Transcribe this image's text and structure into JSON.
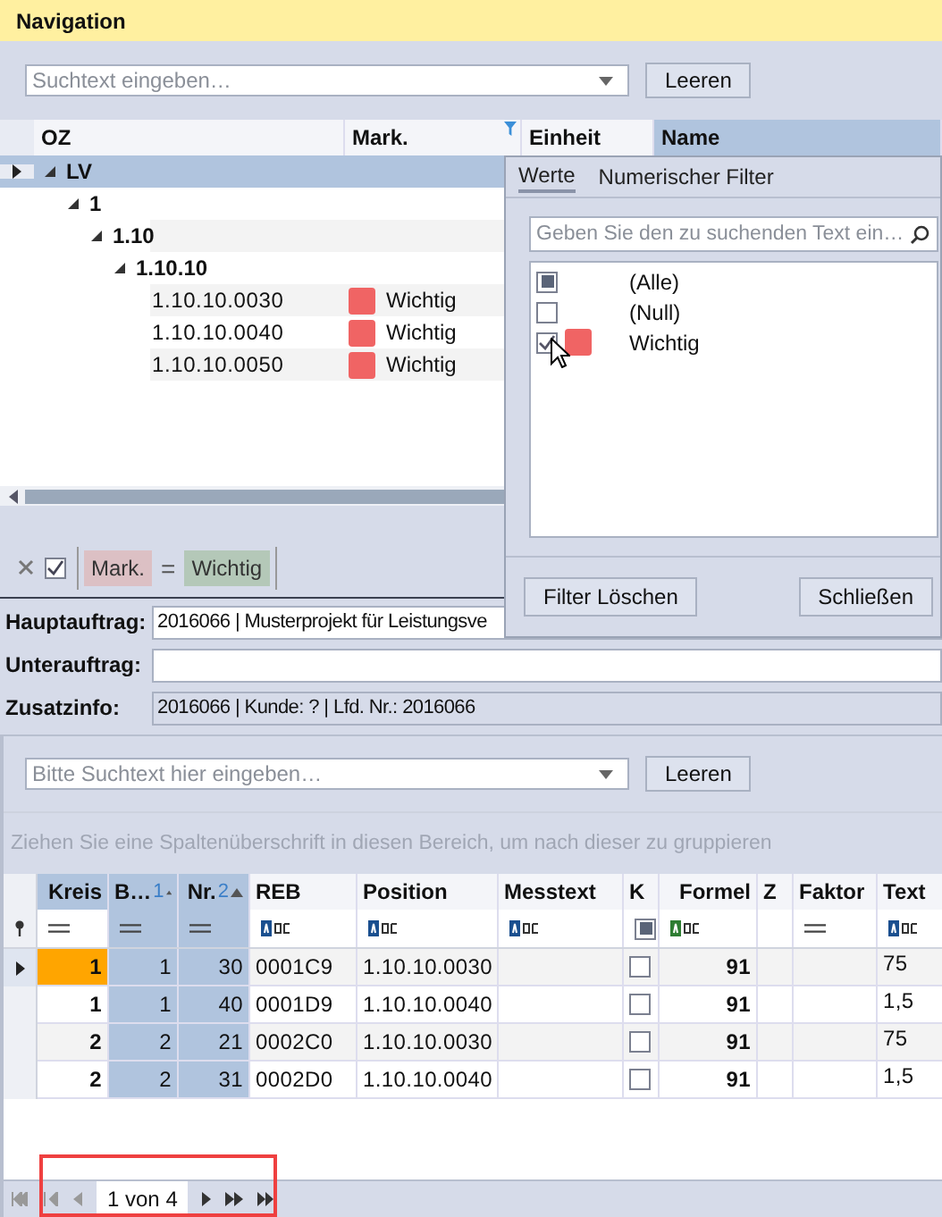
{
  "panel_title": "Navigation",
  "search": {
    "placeholder": "Suchtext eingeben…",
    "button": "Leeren"
  },
  "tree": {
    "columns": [
      {
        "title": "OZ",
        "filtered": false
      },
      {
        "title": "Mark.",
        "filtered": true
      },
      {
        "title": "Einheit",
        "filtered": false
      },
      {
        "title": "Name",
        "filtered": false
      }
    ],
    "nodes": [
      {
        "label": "LV",
        "selected": true,
        "expanded": true,
        "children": [
          {
            "label": "1",
            "selected": false,
            "expanded": true,
            "children": [
              {
                "label": "1.10",
                "selected": false,
                "expanded": true,
                "children": [
                  {
                    "label": "1.10.10",
                    "selected": false,
                    "expanded": true,
                    "children": [
                      {
                        "label": "1.10.10.0030",
                        "selected": false,
                        "mark": {
                          "label": "Wichtig",
                          "color": "#f06464"
                        }
                      },
                      {
                        "label": "1.10.10.0040",
                        "selected": false,
                        "mark": {
                          "label": "Wichtig",
                          "color": "#f06464"
                        }
                      },
                      {
                        "label": "1.10.10.0050",
                        "selected": false,
                        "mark": {
                          "label": "Wichtig",
                          "color": "#f06464"
                        }
                      }
                    ]
                  }
                ]
              }
            ]
          }
        ]
      }
    ]
  },
  "filter_bar": {
    "enabled": true,
    "field": "Mark.",
    "operator": "=",
    "value": "Wichtig"
  },
  "filter_popup": {
    "tabs": [
      {
        "label": "Werte",
        "selected": true
      },
      {
        "label": "Numerischer Filter",
        "selected": false
      }
    ],
    "search_placeholder": "Geben Sie den zu suchenden Text ein…",
    "items": [
      {
        "label": "(Alle)",
        "kind": "partial"
      },
      {
        "label": "(Null)",
        "kind": "checkbox",
        "checked": false
      },
      {
        "label": "Wichtig",
        "kind": "checkbox",
        "checked": true,
        "color": "#f06464"
      }
    ],
    "buttons": [
      "Filter Löschen",
      "Schließen"
    ]
  },
  "info": [
    {
      "label": "Hauptauftrag:",
      "kind": "input",
      "value": "2016066 | Musterprojekt für Leistungsve"
    },
    {
      "label": "Unterauftrag:",
      "kind": "input"
    },
    {
      "label": "Zusatzinfo:",
      "kind": "readonly",
      "value": "2016066 | Kunde: ? | Lfd. Nr.: 2016066"
    }
  ],
  "grid": {
    "search": {
      "placeholder": "Bitte Suchtext hier eingeben…",
      "button": "Leeren"
    },
    "group_hint": "Ziehen Sie eine Spaltenüberschrift in diesen Bereich, um nach dieser zu gruppieren",
    "columns": [
      {
        "title": "Kreis",
        "kind": "number",
        "highlighted": true,
        "sorted": false
      },
      {
        "title": "B…",
        "sort_order": "1",
        "kind": "number",
        "highlighted": false,
        "sorted": true
      },
      {
        "title": "Nr.",
        "sort_order": "2",
        "kind": "number",
        "highlighted": false,
        "sorted": true
      },
      {
        "title": "REB",
        "kind": "text",
        "highlighted": false,
        "sorted": false
      },
      {
        "title": "Position",
        "kind": "text",
        "highlighted": false,
        "sorted": false
      },
      {
        "title": "Messtext",
        "kind": "text",
        "highlighted": false,
        "sorted": false
      },
      {
        "title": "K",
        "kind": "check",
        "highlighted": false,
        "sorted": false
      },
      {
        "title": "Formel",
        "kind": "formula",
        "highlighted": false,
        "sorted": false
      },
      {
        "title": "Z",
        "kind": "plain",
        "highlighted": false,
        "sorted": false
      },
      {
        "title": "Faktor",
        "kind": "number",
        "highlighted": false,
        "sorted": false
      },
      {
        "title": "Text",
        "kind": "text",
        "highlighted": false,
        "sorted": false
      }
    ],
    "rows": [
      {
        "selected": true,
        "cells": [
          "1",
          "1",
          "30",
          "0001C9",
          "1.10.10.0030",
          null,
          false,
          "91",
          null,
          null,
          "75"
        ]
      },
      {
        "selected": false,
        "cells": [
          "1",
          "1",
          "40",
          "0001D9",
          "1.10.10.0040",
          null,
          false,
          "91",
          null,
          null,
          "1,5"
        ]
      },
      {
        "selected": false,
        "cells": [
          "2",
          "2",
          "21",
          "0002C0",
          "1.10.10.0030",
          null,
          false,
          "91",
          null,
          null,
          "75"
        ]
      },
      {
        "selected": false,
        "cells": [
          "2",
          "2",
          "31",
          "0002D0",
          "1.10.10.0040",
          null,
          false,
          "91",
          null,
          null,
          "1,5"
        ]
      }
    ]
  },
  "pager": {
    "text": "1 von 4",
    "highlighted": true
  }
}
